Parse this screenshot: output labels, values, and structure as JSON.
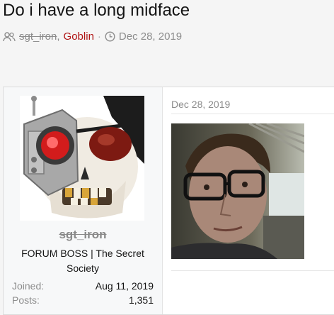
{
  "thread": {
    "title": "Do i have a long midface",
    "starter": "sgt_iron",
    "comma": ",",
    "other_participant": "Goblin",
    "separator": "·",
    "date": "Dec 28, 2019"
  },
  "post": {
    "date": "Dec 28, 2019",
    "user": {
      "name": "sgt_iron",
      "title": "FORUM BOSS | The Secret Society",
      "stats": [
        {
          "label": "Joined:",
          "value": "Aug 11, 2019"
        },
        {
          "label": "Posts:",
          "value": "1,351"
        }
      ]
    }
  },
  "icons": {
    "participants": "users-icon",
    "clock": "clock-icon"
  },
  "colors": {
    "accent_link": "#b01515",
    "muted": "#8c8c8c"
  }
}
